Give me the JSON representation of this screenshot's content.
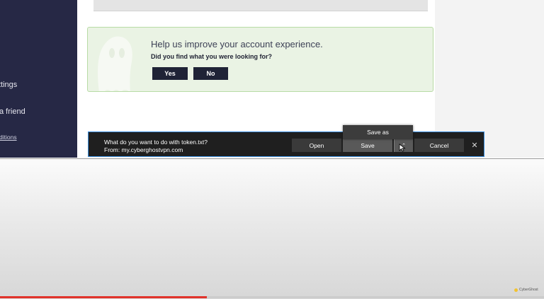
{
  "sidebar": {
    "items": [
      {
        "label": "ttings"
      },
      {
        "label": "a friend"
      },
      {
        "label": "ditions"
      }
    ]
  },
  "feedback": {
    "title": "Help us improve your account experience.",
    "question": "Did you find what you were looking for?",
    "yes_label": "Yes",
    "no_label": "No"
  },
  "download_bar": {
    "prompt": "What do you want to do with token.txt?",
    "source": "From: my.cyberghostvpn.com",
    "open_label": "Open",
    "save_label": "Save",
    "cancel_label": "Cancel",
    "close_icon": "close-icon",
    "dropdown": {
      "save_as_label": "Save as"
    }
  },
  "video": {
    "progress": 0.38,
    "progress_color": "#e0322a",
    "watermark": "CyberGhost"
  },
  "colors": {
    "sidebar_bg": "#262845",
    "feedback_bg": "#eaf3e4",
    "feedback_border": "#b8dba5",
    "download_accent": "#3b8fe0"
  }
}
